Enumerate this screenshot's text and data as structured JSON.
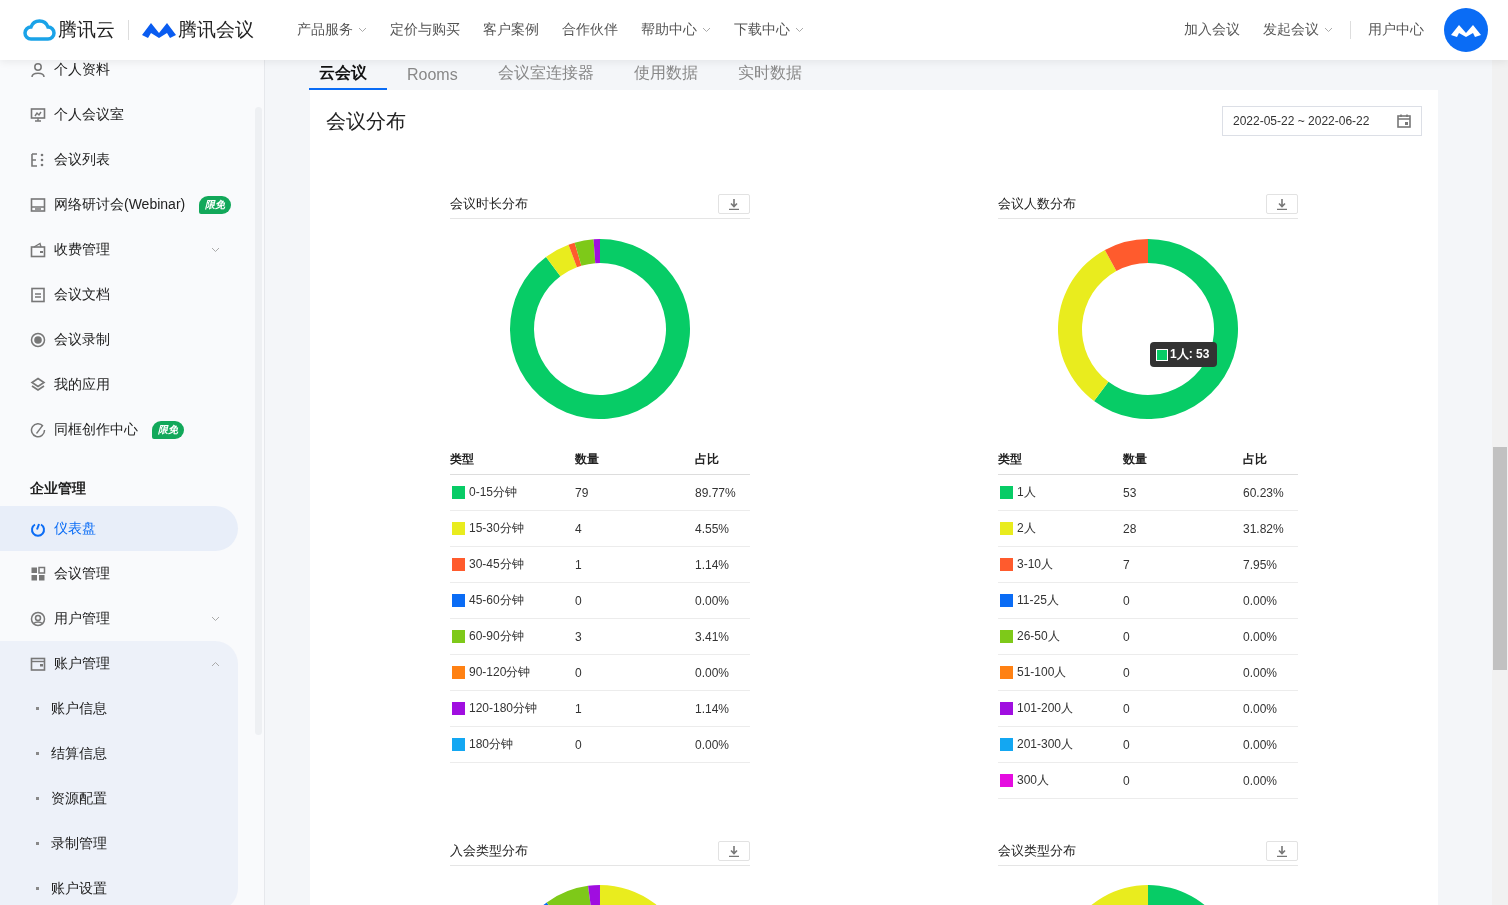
{
  "header": {
    "brand_cloud": "腾讯云",
    "brand_meeting": "腾讯会议",
    "nav": [
      {
        "label": "产品服务",
        "dropdown": true
      },
      {
        "label": "定价与购买",
        "dropdown": false
      },
      {
        "label": "客户案例",
        "dropdown": false
      },
      {
        "label": "合作伙伴",
        "dropdown": false
      },
      {
        "label": "帮助中心",
        "dropdown": true
      },
      {
        "label": "下载中心",
        "dropdown": true
      }
    ],
    "actions": [
      {
        "label": "加入会议",
        "dropdown": false
      },
      {
        "label": "发起会议",
        "dropdown": true
      },
      {
        "label": "用户中心",
        "dropdown": false
      }
    ]
  },
  "sidebar": {
    "items": [
      {
        "label": "个人资料",
        "selected": false
      },
      {
        "label": "个人会议室",
        "selected": false
      },
      {
        "label": "会议列表",
        "selected": false
      },
      {
        "label": "网络研讨会(Webinar)",
        "badge": "限免",
        "selected": false
      },
      {
        "label": "收费管理",
        "selected": false,
        "expanded": false
      },
      {
        "label": "会议文档",
        "selected": false
      },
      {
        "label": "会议录制",
        "selected": false
      },
      {
        "label": "我的应用",
        "selected": false
      },
      {
        "label": "同框创作中心",
        "badge": "限免",
        "selected": false
      }
    ],
    "section": "企业管理",
    "section_items": [
      {
        "label": "仪表盘",
        "selected": true
      },
      {
        "label": "会议管理",
        "selected": false
      },
      {
        "label": "用户管理",
        "selected": false,
        "expanded": false
      },
      {
        "label": "账户管理",
        "selected": false,
        "expanded": true,
        "children": [
          {
            "label": "账户信息",
            "selected": false
          },
          {
            "label": "结算信息",
            "selected": false
          },
          {
            "label": "资源配置",
            "selected": false
          },
          {
            "label": "录制管理",
            "selected": false
          },
          {
            "label": "账户设置",
            "selected": false
          }
        ]
      }
    ]
  },
  "tabs": [
    {
      "label": "云会议",
      "selected": true
    },
    {
      "label": "Rooms",
      "selected": false
    },
    {
      "label": "会议室连接器",
      "selected": false
    },
    {
      "label": "使用数据",
      "selected": false
    },
    {
      "label": "实时数据",
      "selected": false
    }
  ],
  "card": {
    "title": "会议分布",
    "date_range": "2022-05-22 ~ 2022-06-22",
    "charts": [
      {
        "chart_data": {
          "type": "donut",
          "title": "会议时长分布",
          "values": [
            89.77,
            4.55,
            1.14,
            0,
            3.41,
            0,
            1.14,
            0
          ]
        },
        "table": {
          "columns": [
            "类型",
            "数量",
            "占比"
          ],
          "rows": [
            {
              "type": "0-15分钟",
              "count": "79",
              "share": "89.77%",
              "color": "#07cc66"
            },
            {
              "type": "15-30分钟",
              "count": "4",
              "share": "4.55%",
              "color": "#e9ec1e"
            },
            {
              "type": "30-45分钟",
              "count": "1",
              "share": "1.14%",
              "color": "#ff5b2d"
            },
            {
              "type": "45-60分钟",
              "count": "0",
              "share": "0.00%",
              "color": "#0a6cf5"
            },
            {
              "type": "60-90分钟",
              "count": "3",
              "share": "3.41%",
              "color": "#7ec919"
            },
            {
              "type": "90-120分钟",
              "count": "0",
              "share": "0.00%",
              "color": "#ff8113"
            },
            {
              "type": "120-180分钟",
              "count": "1",
              "share": "1.14%",
              "color": "#a00ee0"
            },
            {
              "type": "180分钟",
              "count": "0",
              "share": "0.00%",
              "color": "#13a7f2"
            }
          ]
        }
      },
      {
        "chart_data": {
          "type": "donut",
          "title": "会议人数分布",
          "values": [
            60.23,
            31.82,
            7.95,
            0,
            0,
            0,
            0,
            0,
            0
          ]
        },
        "tooltip": {
          "text": "1人: 53",
          "color": "#07cc66"
        },
        "table": {
          "columns": [
            "类型",
            "数量",
            "占比"
          ],
          "rows": [
            {
              "type": "1人",
              "count": "53",
              "share": "60.23%",
              "color": "#07cc66"
            },
            {
              "type": "2人",
              "count": "28",
              "share": "31.82%",
              "color": "#e9ec1e"
            },
            {
              "type": "3-10人",
              "count": "7",
              "share": "7.95%",
              "color": "#ff5b2d"
            },
            {
              "type": "11-25人",
              "count": "0",
              "share": "0.00%",
              "color": "#0a6cf5"
            },
            {
              "type": "26-50人",
              "count": "0",
              "share": "0.00%",
              "color": "#7ec919"
            },
            {
              "type": "51-100人",
              "count": "0",
              "share": "0.00%",
              "color": "#ff8113"
            },
            {
              "type": "101-200人",
              "count": "0",
              "share": "0.00%",
              "color": "#a00ee0"
            },
            {
              "type": "201-300人",
              "count": "0",
              "share": "0.00%",
              "color": "#13a7f2"
            },
            {
              "type": "300人",
              "count": "0",
              "share": "0.00%",
              "color": "#e50ce0"
            }
          ]
        }
      },
      {
        "title": "入会类型分布",
        "kind": "partial"
      },
      {
        "title": "会议类型分布",
        "kind": "partial"
      }
    ]
  }
}
